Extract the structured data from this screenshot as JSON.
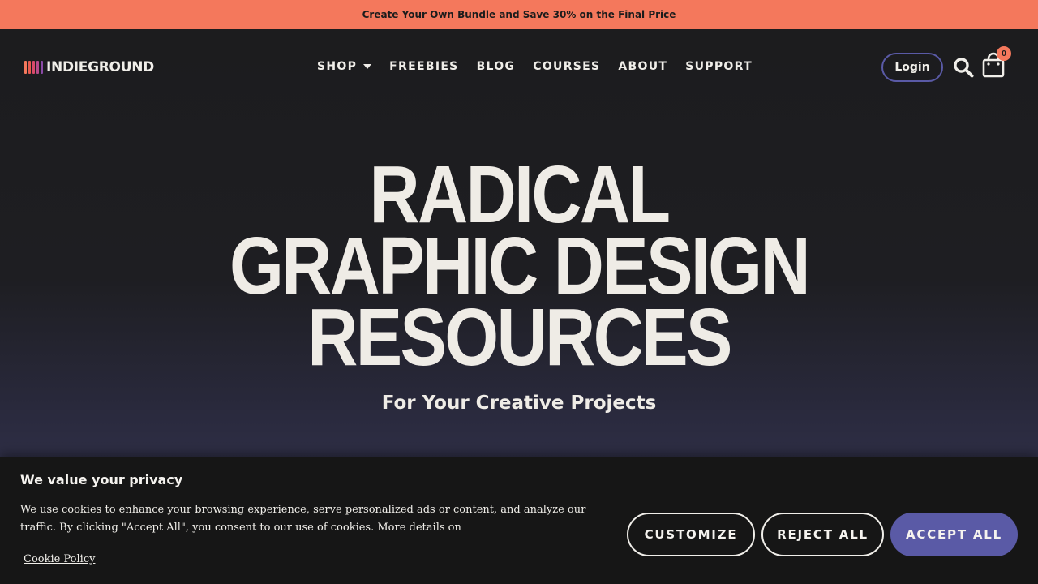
{
  "promo": {
    "text": "Create Your Own Bundle and Save 30% on the Final Price"
  },
  "brand": {
    "name": "INDIEGROUND",
    "bar_colors": [
      "#f4785c",
      "#e85a4f",
      "#d94a6a",
      "#b84a8a",
      "#8a4aa6"
    ]
  },
  "nav": {
    "items": [
      {
        "label": "SHOP",
        "has_dropdown": true
      },
      {
        "label": "FREEBIES"
      },
      {
        "label": "BLOG"
      },
      {
        "label": "COURSES"
      },
      {
        "label": "ABOUT"
      },
      {
        "label": "SUPPORT"
      }
    ]
  },
  "header_actions": {
    "login_label": "Login",
    "cart_count": "0",
    "search_icon": "search-icon",
    "cart_icon": "shopping-bag-icon"
  },
  "hero": {
    "title_lines": [
      "RADICAL",
      "GRAPHIC DESIGN",
      "RESOURCES"
    ],
    "subtitle": "For Your Creative Projects"
  },
  "cookie": {
    "title": "We value your privacy",
    "text": "We use cookies to enhance your browsing experience, serve personalized ads or content, and analyze our traffic. By clicking \"Accept All\", you consent to our use of cookies. More details on",
    "policy_link": "Cookie Policy",
    "customize_label": "CUSTOMIZE",
    "reject_label": "REJECT ALL",
    "accept_label": "ACCEPT ALL"
  },
  "colors": {
    "accent_orange": "#f4785c",
    "accent_purple": "#5a5aa6",
    "background": "#1a1a1c",
    "text_light": "#f0eee9"
  }
}
